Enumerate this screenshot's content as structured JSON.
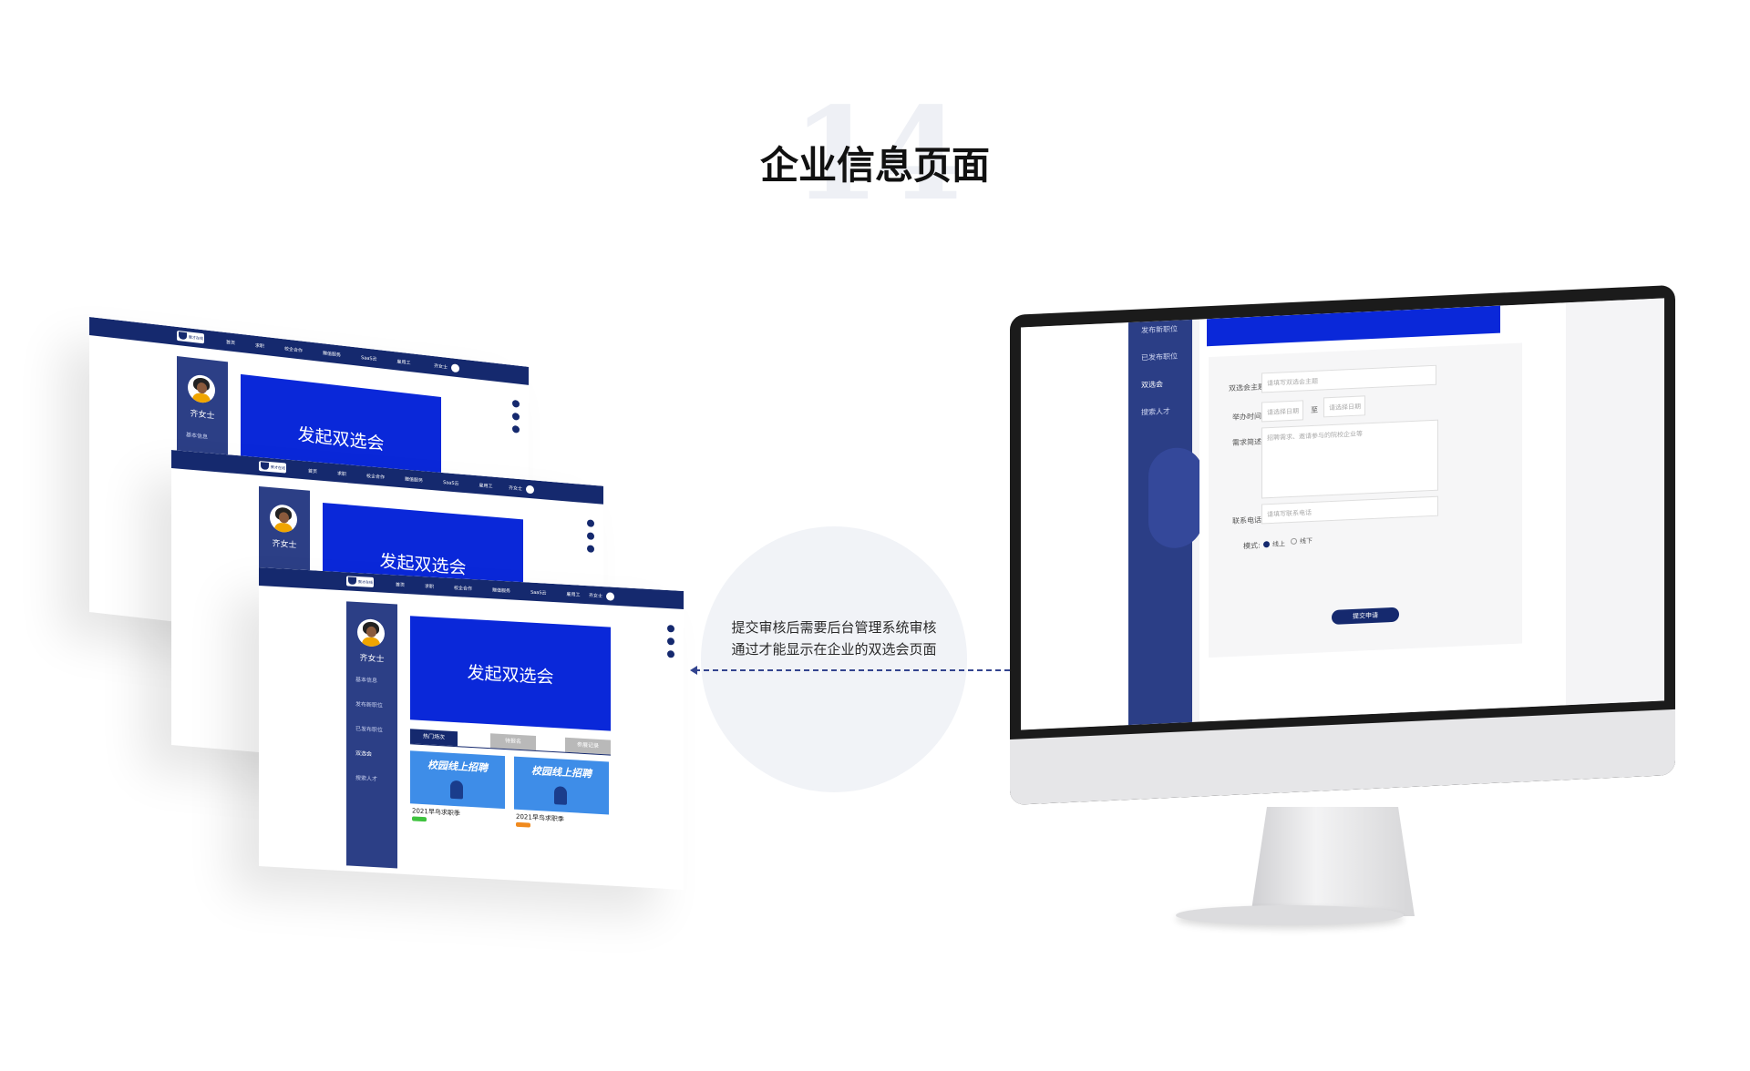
{
  "title": {
    "number": "14",
    "text": "企业信息页面"
  },
  "note": {
    "line1": "提交审核后需要后台管理系统审核",
    "line2": "通过才能显示在企业的双选会页面"
  },
  "site": {
    "logo_text": "聚才在线",
    "nav": [
      "首页",
      "求职",
      "校企合作",
      "赠值服务",
      "SaaS云",
      "雇用工"
    ],
    "user_name": "齐女士"
  },
  "sidebar": {
    "name": "齐女士",
    "items": [
      "基本信息",
      "发布新职位",
      "已发布职位",
      "双选会",
      "搜索人才"
    ],
    "active": "双选会"
  },
  "banner": {
    "text": "发起双选会"
  },
  "tabs": {
    "hot": "热门场次",
    "waiting": "待报名",
    "records": "参展记录"
  },
  "cards": [
    {
      "image_title": "校园线上招聘",
      "title": "2021早鸟求职季",
      "tag_color": "#3ec23e"
    },
    {
      "image_title": "校园线上招聘",
      "title": "2021早鸟求职季",
      "tag_color": "#f08a1e"
    }
  ],
  "form": {
    "topic_label": "双选会主题:",
    "topic_placeholder": "请填写双选会主题",
    "time_label": "举办时间:",
    "start_placeholder": "请选择日期",
    "to": "至",
    "end_placeholder": "请选择日期",
    "desc_label": "需求简述:",
    "desc_placeholder": "招聘需求、邀请参与的院校企业等",
    "phone_label": "联系电话:",
    "phone_placeholder": "请填写联系电话",
    "mode_label": "模式:",
    "mode_options": [
      "线上",
      "线下"
    ],
    "mode_selected": "线上",
    "submit_label": "提交申请"
  },
  "colors": {
    "brand_navy": "#15296e",
    "brand_blue": "#0a28d9",
    "sidebar": "#2c3f86"
  }
}
